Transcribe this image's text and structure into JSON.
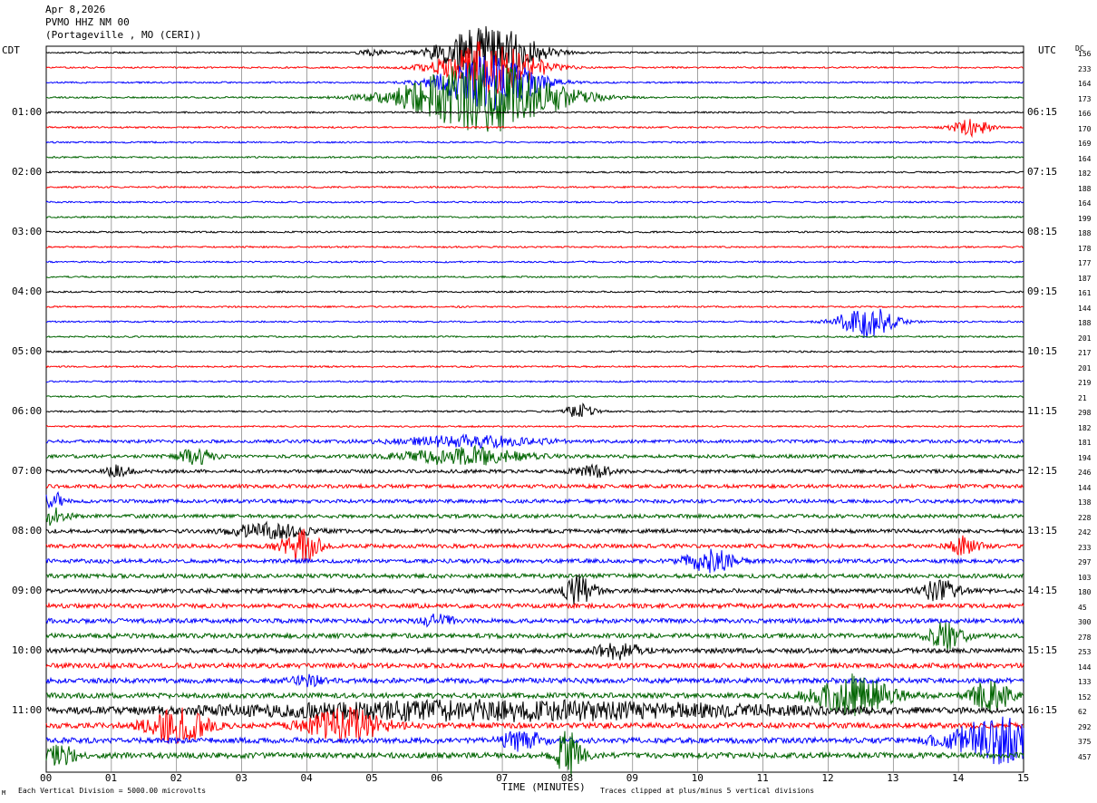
{
  "header": {
    "date": "Apr 8,2026",
    "station": "PVMO HHZ NM 00",
    "location": "(Portageville , MO (CERI))"
  },
  "left_timezone": "CDT",
  "right_timezone": "UTC",
  "dc_label": "DC",
  "chart_data": {
    "type": "line",
    "xlabel": "TIME (MINUTES)",
    "x_ticks": [
      "00",
      "01",
      "02",
      "03",
      "04",
      "05",
      "06",
      "07",
      "08",
      "09",
      "10",
      "11",
      "12",
      "13",
      "14",
      "15"
    ],
    "xlim": [
      0,
      15
    ],
    "left_hour_labels": [
      "01:00",
      "02:00",
      "03:00",
      "04:00",
      "05:00",
      "06:00",
      "07:00",
      "08:00",
      "09:00",
      "10:00",
      "11:00"
    ],
    "right_hour_labels": [
      "06:15",
      "07:15",
      "08:15",
      "09:15",
      "10:15",
      "11:15",
      "12:15",
      "13:15",
      "14:15",
      "15:15",
      "16:15"
    ],
    "trace_colors": [
      "#000000",
      "#ff0000",
      "#0000ff",
      "#006400"
    ],
    "dc_values": [
      "156",
      "233",
      "164",
      "173",
      "166",
      "170",
      "169",
      "164",
      "182",
      "188",
      "164",
      "199",
      "188",
      "178",
      "177",
      "187",
      "161",
      "144",
      "188",
      "201",
      "217",
      "201",
      "219",
      "21",
      "298",
      "182",
      "181",
      "194",
      "246",
      "144",
      "138",
      "228",
      "242",
      "233",
      "297",
      "103",
      "180",
      "45",
      "300",
      "278",
      "253",
      "144",
      "133",
      "152",
      "62",
      "292",
      "375",
      "457"
    ],
    "footnote_left": "Each Vertical Division = 5000.00 microvolts",
    "footnote_right": "Traces clipped at plus/minus 5 vertical divisions",
    "corner_mark": "M"
  }
}
